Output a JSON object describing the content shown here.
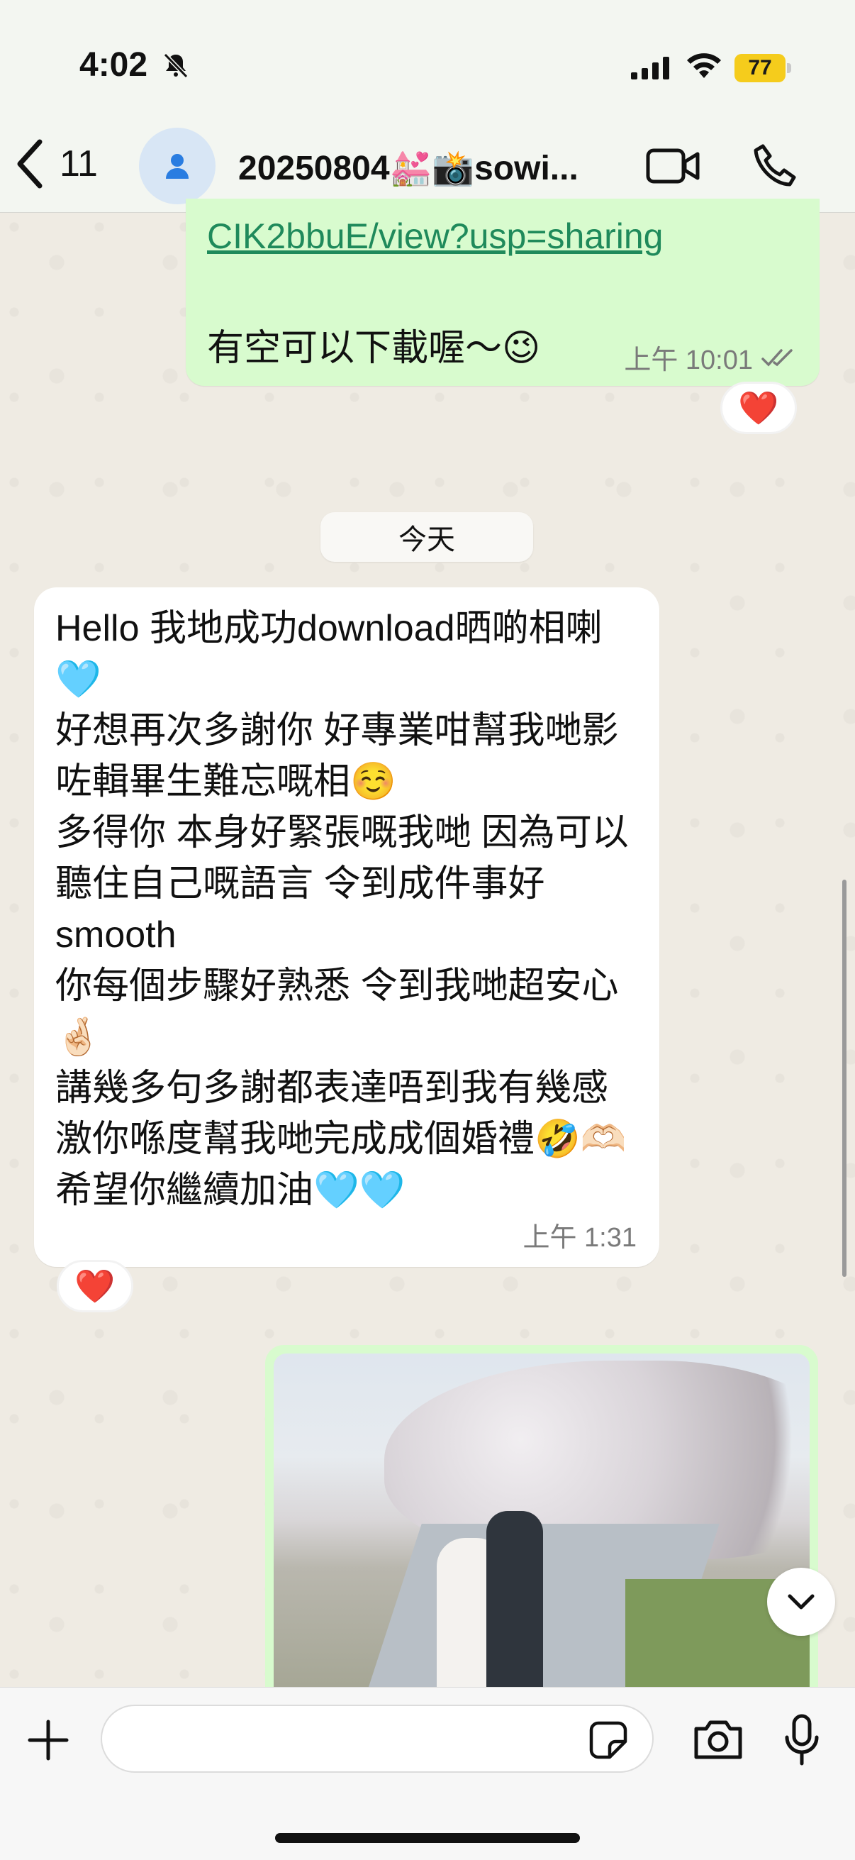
{
  "status_bar": {
    "time": "4:02",
    "battery_level": "77",
    "icons": [
      "bell-slash-icon",
      "cellular-signal-icon",
      "wifi-icon",
      "battery-icon"
    ]
  },
  "header": {
    "back_count": "11",
    "title": "20250804💒📸sowi...",
    "icons": [
      "chevron-left-icon",
      "person-icon",
      "video-camera-icon",
      "phone-icon"
    ]
  },
  "messages": [
    {
      "direction": "outgoing",
      "link": "CIK2bbuE/view?usp=sharing",
      "text": "有空可以下載喔～😉",
      "time": "上午 10:01",
      "reaction": "❤️"
    },
    {
      "direction": "incoming",
      "text": "Hello 我地成功download晒啲相喇🩵\n好想再次多謝你 好專業咁幫我哋影咗輯畢生難忘嘅相☺️\n多得你 本身好緊張嘅我哋 因為可以聽住自己嘅語言 令到成件事好 smooth\n你每個步驟好熟悉 令到我哋超安心🤞🏻\n講幾多句多謝都表達唔到我有幾感激你喺度幫我哋完成成個婚禮🤣🫶🏻\n希望你繼續加油🩵🩵",
      "time": "上午 1:31",
      "reaction": "❤️"
    }
  ],
  "date_separator": "今天",
  "input": {
    "placeholder": "",
    "value": ""
  },
  "colors": {
    "outgoing_bubble": "#d8fbce",
    "incoming_bubble": "#ffffff",
    "link": "#1f8a5b",
    "battery": "#f5cc1c"
  }
}
